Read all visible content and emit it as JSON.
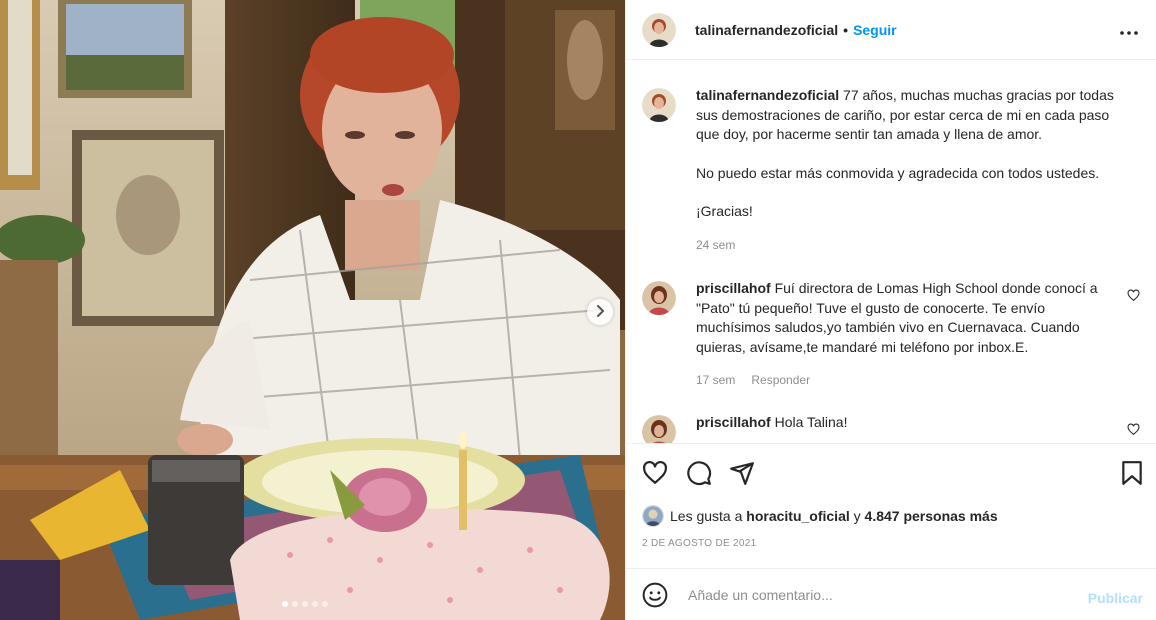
{
  "post": {
    "author": "talinafernandezoficial",
    "follow_label": "Seguir",
    "separator": "•",
    "caption": {
      "username": "talinafernandezoficial",
      "text": "77 años, muchas muchas gracias por todas sus demostraciones de cariño, por estar cerca de mi en cada paso que doy, por hacerme sentir tan amada y llena de amor.",
      "paragraph2": "No puedo estar más conmovida y agradecida con todos ustedes.",
      "paragraph3": "¡Gracias!",
      "time": "24 sem"
    },
    "comments": [
      {
        "username": "priscillahof",
        "text": "Fuí directora de Lomas High School donde conocí a \"Pato\" tú pequeño! Tuve el gusto de conocerte. Te envío muchísimos saludos,yo también vivo en Cuernavaca. Cuando quieras, avísame,te mandaré mi teléfono por inbox.E.",
        "time": "17 sem",
        "reply_label": "Responder"
      },
      {
        "username": "priscillahof",
        "text": "Hola Talina!"
      }
    ],
    "likes": {
      "prefix": "Les gusta a",
      "user": "horacitu_oficial",
      "connector": "y",
      "others": "4.847 personas más"
    },
    "date": "2 DE AGOSTO DE 2021",
    "add_comment": {
      "placeholder": "Añade un comentario...",
      "publish_label": "Publicar"
    },
    "carousel": {
      "dot_count": 5,
      "active_index": 0
    }
  },
  "icons": {
    "more": "more-options-icon",
    "like": "heart-icon",
    "comment": "comment-icon",
    "share": "share-icon",
    "save": "bookmark-icon",
    "emoji": "emoji-icon",
    "next": "chevron-right-icon"
  },
  "colors": {
    "link_blue": "#0095f6",
    "publish_disabled": "#b2dffc",
    "secondary_text": "#8e8e8e",
    "divider": "#efefef"
  }
}
